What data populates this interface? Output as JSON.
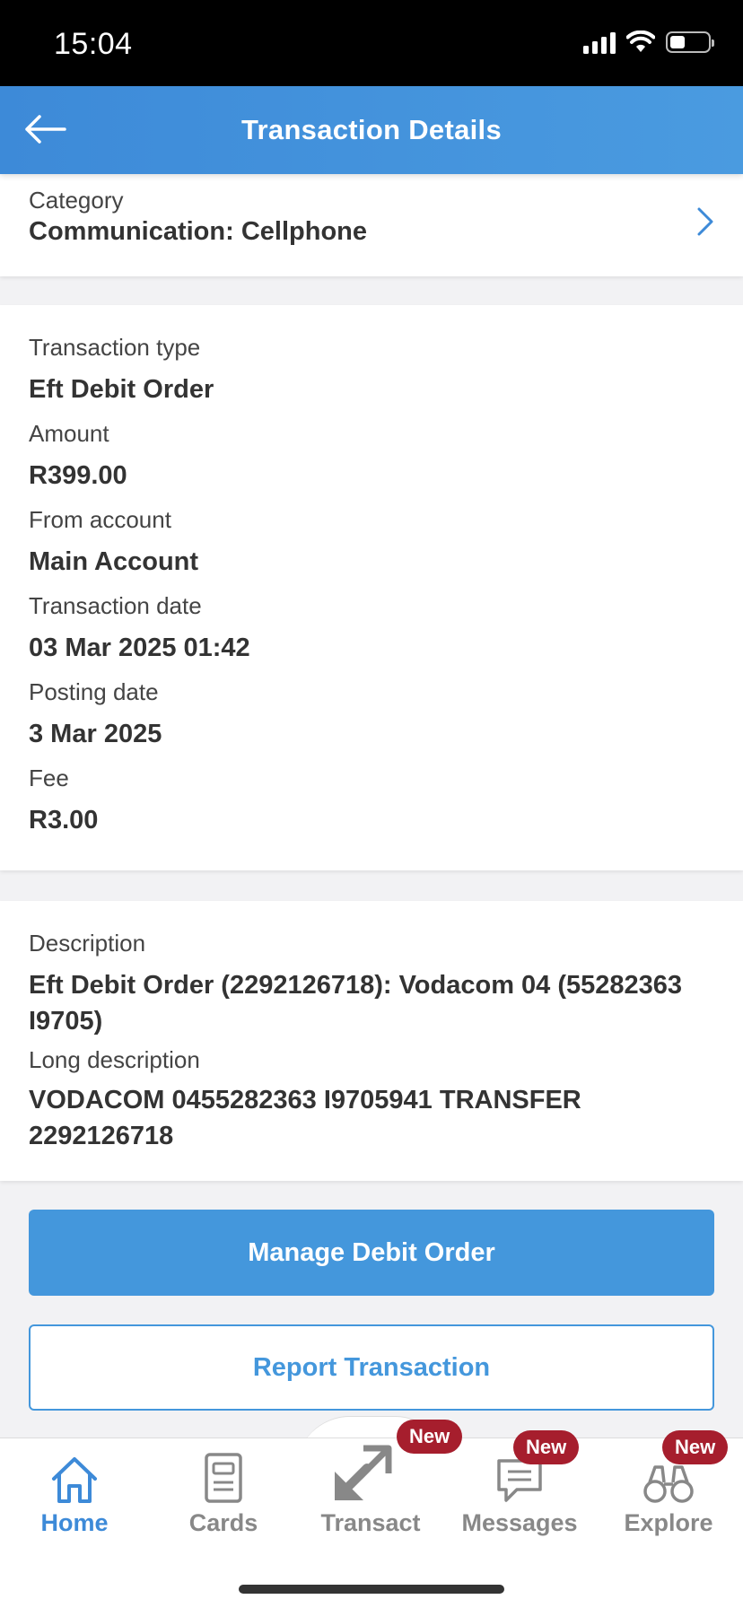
{
  "status": {
    "time": "15:04"
  },
  "header": {
    "title": "Transaction Details"
  },
  "category": {
    "label": "Category",
    "value": "Communication: Cellphone"
  },
  "details": {
    "type_label": "Transaction type",
    "type_value": "Eft Debit Order",
    "amount_label": "Amount",
    "amount_value": "R399.00",
    "from_label": "From account",
    "from_value": "Main Account",
    "tdate_label": "Transaction date",
    "tdate_value": "03 Mar 2025 01:42",
    "pdate_label": "Posting date",
    "pdate_value": "3 Mar 2025",
    "fee_label": "Fee",
    "fee_value": "R3.00"
  },
  "description": {
    "label": "Description",
    "value_line1": "Eft Debit Order (2292126718): Vodacom 04 (55282363",
    "value_line2": "I9705)",
    "long_label": "Long description",
    "long_line1": "VODACOM 0455282363 I9705941 TRANSFER",
    "long_line2": "2292126718"
  },
  "actions": {
    "manage": "Manage Debit Order",
    "report": "Report Transaction"
  },
  "tabs": [
    {
      "label": "Home",
      "icon": "home-icon",
      "active": true
    },
    {
      "label": "Cards",
      "icon": "card-icon",
      "active": false
    },
    {
      "label": "Transact",
      "icon": "transact-arrows-icon",
      "active": false,
      "badge": "New"
    },
    {
      "label": "Messages",
      "icon": "message-icon",
      "active": false,
      "badge": "New"
    },
    {
      "label": "Explore",
      "icon": "binoculars-icon",
      "active": false,
      "badge": "New"
    }
  ],
  "colors": {
    "primary": "#4497dc",
    "badge": "#a61e2d",
    "header": "#3d8ad8"
  }
}
